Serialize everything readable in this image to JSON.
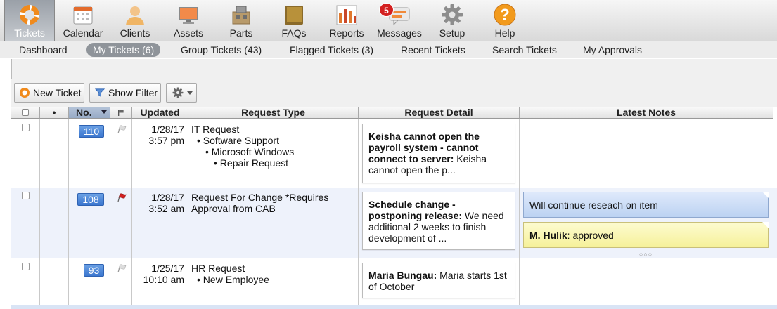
{
  "nav": {
    "items": [
      {
        "label": "Tickets",
        "icon": "lifebuoy-icon"
      },
      {
        "label": "Calendar",
        "icon": "calendar-icon"
      },
      {
        "label": "Clients",
        "icon": "person-icon"
      },
      {
        "label": "Assets",
        "icon": "monitor-icon"
      },
      {
        "label": "Parts",
        "icon": "parts-box-icon"
      },
      {
        "label": "FAQs",
        "icon": "book-icon"
      },
      {
        "label": "Reports",
        "icon": "bar-chart-icon"
      },
      {
        "label": "Messages",
        "icon": "chat-icon"
      },
      {
        "label": "Setup",
        "icon": "gear-icon"
      },
      {
        "label": "Help",
        "icon": "question-icon"
      }
    ],
    "messages_badge": "5",
    "active": "Tickets"
  },
  "subnav": {
    "items": [
      "Dashboard",
      "My Tickets (6)",
      "Group Tickets (43)",
      "Flagged Tickets (3)",
      "Recent Tickets",
      "Search Tickets",
      "My Approvals"
    ],
    "active": "My Tickets (6)"
  },
  "toolbar": {
    "new_ticket": "New Ticket",
    "show_filter": "Show Filter"
  },
  "columns": {
    "dot": "•",
    "number": "No.",
    "updated": "Updated",
    "request_type": "Request Type",
    "request_detail": "Request Detail",
    "latest_notes": "Latest Notes"
  },
  "colors": {
    "accent": "#3b76cf",
    "flag_red": "#d32020",
    "note_blue": "#c9daf5",
    "note_yellow": "#faf5b0"
  },
  "rows": [
    {
      "number": "110",
      "flagged": false,
      "updated_date": "1/28/17",
      "updated_time": "3:57 pm",
      "type": [
        "IT Request",
        "Software Support",
        "Microsoft Windows",
        "Repair Request"
      ],
      "detail_title": "Keisha cannot open the payroll system - cannot connect to server:",
      "detail_text": "Keisha cannot open the p...",
      "notes": []
    },
    {
      "number": "108",
      "flagged": true,
      "updated_date": "1/28/17",
      "updated_time": "3:52 am",
      "type": [
        "Request For Change *Requires Approval from CAB"
      ],
      "detail_title": "Schedule change - postponing release:",
      "detail_text": "We need additional 2 weeks to finish development of ...",
      "notes": [
        {
          "text": "Will continue reseach on item"
        },
        {
          "author": "M. Hulik",
          "text": ": approved"
        }
      ]
    },
    {
      "number": "93",
      "flagged": false,
      "updated_date": "1/25/17",
      "updated_time": "10:10 am",
      "type": [
        "HR Request",
        "New Employee"
      ],
      "detail_title": "Maria Bungau:",
      "detail_text": "Maria starts 1st of October",
      "notes": []
    }
  ]
}
